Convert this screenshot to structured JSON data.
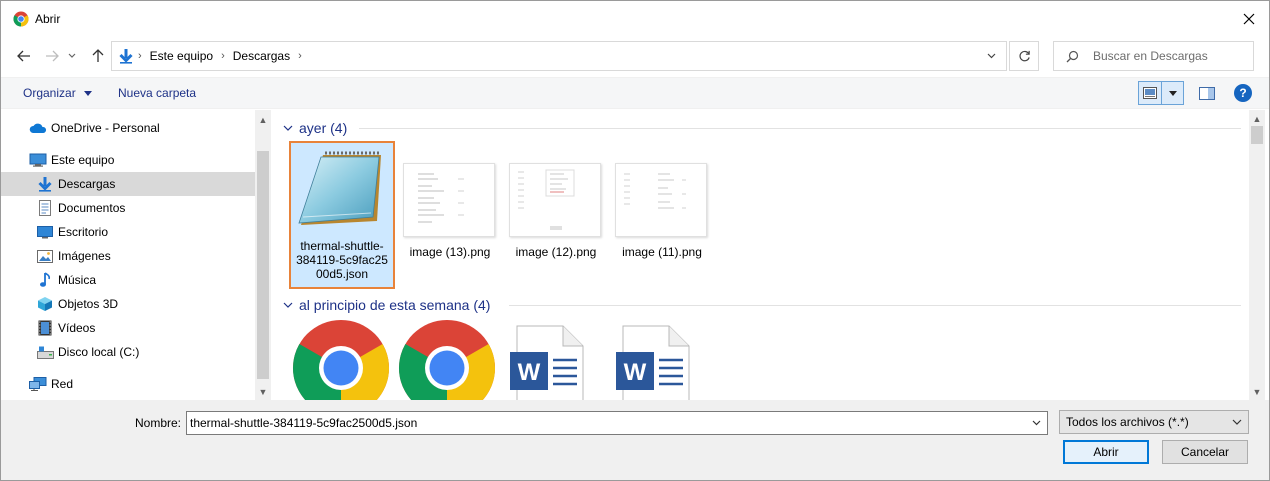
{
  "window": {
    "title": "Abrir"
  },
  "address": {
    "crumbs": [
      "Este equipo",
      "Descargas"
    ]
  },
  "search": {
    "placeholder": "Buscar en Descargas"
  },
  "toolbar": {
    "organize_label": "Organizar",
    "new_folder_label": "Nueva carpeta",
    "help_label": "?"
  },
  "sidebar": {
    "items": [
      {
        "label": "OneDrive - Personal",
        "icon": "onedrive-icon"
      },
      {
        "label": "Este equipo",
        "icon": "computer-icon"
      },
      {
        "label": "Descargas",
        "icon": "download-icon",
        "selected": true
      },
      {
        "label": "Documentos",
        "icon": "document-icon"
      },
      {
        "label": "Escritorio",
        "icon": "desktop-icon"
      },
      {
        "label": "Imágenes",
        "icon": "images-icon"
      },
      {
        "label": "Música",
        "icon": "music-icon"
      },
      {
        "label": "Objetos 3D",
        "icon": "cube-icon"
      },
      {
        "label": "Vídeos",
        "icon": "video-icon"
      },
      {
        "label": "Disco local (C:)",
        "icon": "drive-icon"
      },
      {
        "label": "Red",
        "icon": "network-icon"
      }
    ]
  },
  "groups": [
    {
      "header": "ayer (4)",
      "files": [
        {
          "name": "thermal-shuttle-384119-5c9fac2500d5.json",
          "name_display": "thermal-shuttle-\n384119-5c9fac25\n00d5.json",
          "icon": "notepad-icon",
          "selected": true
        },
        {
          "name": "image (13).png",
          "icon": "png-thumbnail-icon"
        },
        {
          "name": "image (12).png",
          "icon": "png-thumbnail-icon"
        },
        {
          "name": "image (11).png",
          "icon": "png-thumbnail-icon"
        }
      ]
    },
    {
      "header": "al principio de esta semana (4)",
      "files": [
        {
          "icon": "chrome-icon"
        },
        {
          "icon": "chrome-icon"
        },
        {
          "icon": "word-icon"
        },
        {
          "icon": "word-icon"
        }
      ]
    }
  ],
  "bottom": {
    "name_label": "Nombre:",
    "file_name_value": "thermal-shuttle-384119-5c9fac2500d5.json",
    "filter_value": "Todos los archivos (*.*)",
    "open_label": "Abrir",
    "cancel_label": "Cancelar"
  },
  "colors": {
    "accent": "#0078d7",
    "link": "#1e3287",
    "selection_border": "#e8833a",
    "selection_fill": "#cde8ff"
  }
}
